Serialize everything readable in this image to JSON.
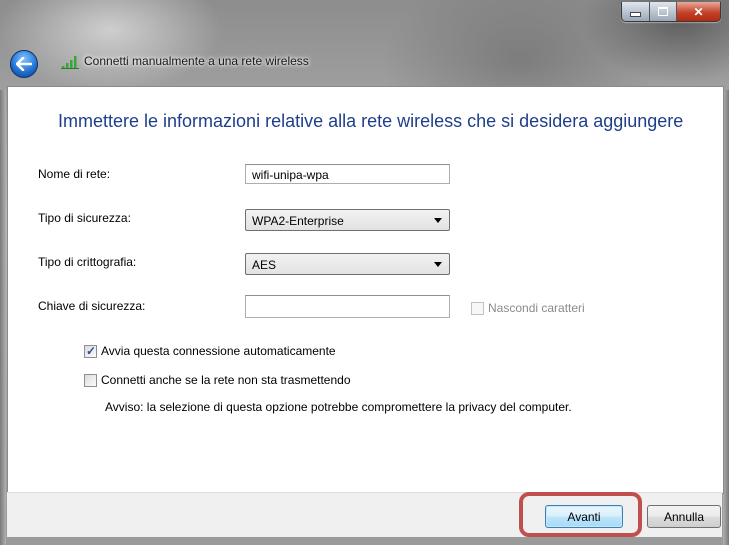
{
  "window": {
    "title": "Connetti manualmente a una rete wireless"
  },
  "heading": "Immettere le informazioni relative alla rete wireless che si desidera aggiungere",
  "fields": {
    "network_name": {
      "label": "Nome di rete:",
      "value": "wifi-unipa-wpa"
    },
    "security_type": {
      "label": "Tipo di sicurezza:",
      "value": "WPA2-Enterprise"
    },
    "encryption_type": {
      "label": "Tipo di crittografia:",
      "value": "AES"
    },
    "security_key": {
      "label": "Chiave di sicurezza:",
      "value": ""
    },
    "hide_chars": {
      "label": "Nascondi caratteri",
      "checked": false,
      "enabled": false
    }
  },
  "options": {
    "auto_start": {
      "label": "Avvia questa connessione automaticamente",
      "checked": true
    },
    "connect_hidden": {
      "label": "Connetti anche se la rete non sta trasmettendo",
      "checked": false
    },
    "warning": "Avviso: la selezione di questa opzione potrebbe compromettere la privacy del computer."
  },
  "buttons": {
    "next": "Avanti",
    "cancel": "Annulla"
  },
  "icons": {
    "back": "back-arrow-icon",
    "wifi": "wireless-signal-icon",
    "minimize": "minimize-icon",
    "maximize": "maximize-icon",
    "close": "close-icon"
  },
  "colors": {
    "heading": "#1e3e8c",
    "highlight": "#c0504d",
    "wifi_signal": "#3aa53a"
  }
}
